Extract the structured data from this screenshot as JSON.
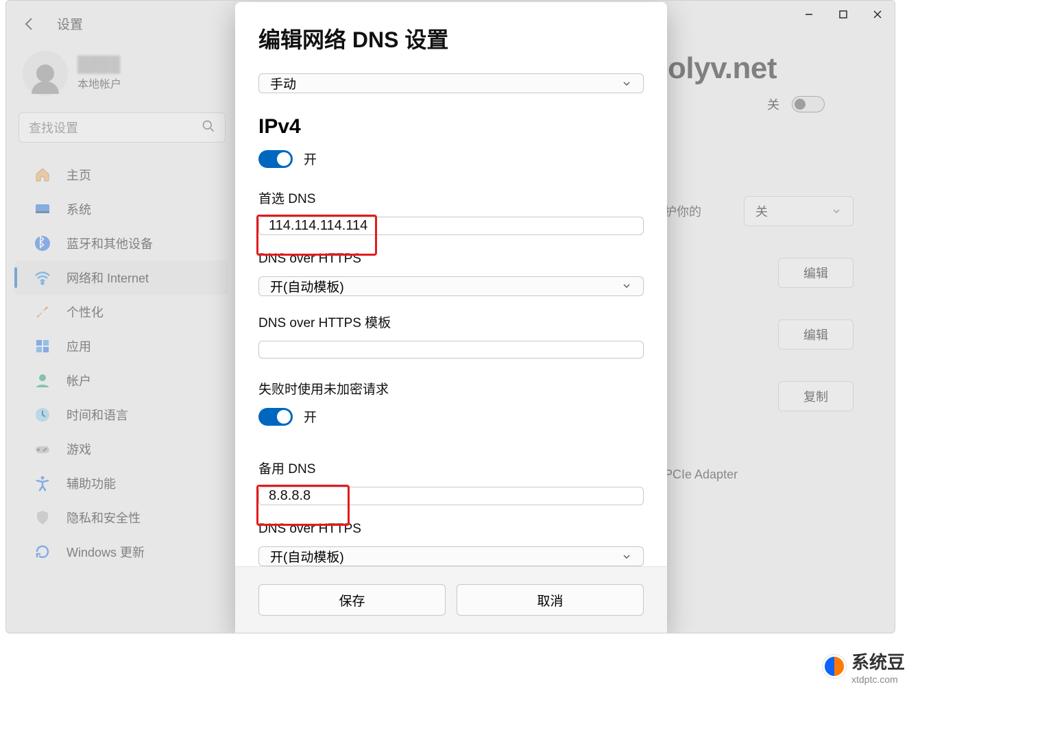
{
  "window": {
    "app_title": "设置",
    "minimize": "–",
    "maximize": "□",
    "close": "✕"
  },
  "profile": {
    "name_blurred": "████",
    "subtitle": "本地帐户"
  },
  "search": {
    "placeholder": "查找设置"
  },
  "nav": {
    "items": [
      {
        "label": "主页"
      },
      {
        "label": "系统"
      },
      {
        "label": "蓝牙和其他设备"
      },
      {
        "label": "网络和 Internet"
      },
      {
        "label": "个性化"
      },
      {
        "label": "应用"
      },
      {
        "label": "帐户"
      },
      {
        "label": "时间和语言"
      },
      {
        "label": "游戏"
      },
      {
        "label": "辅助功能"
      },
      {
        "label": "隐私和安全性"
      },
      {
        "label": "Windows 更新"
      }
    ],
    "active_index": 3
  },
  "background": {
    "domain_fragment": "olyv.net",
    "toggle_off_label": "关",
    "protect_text_fragment": "护你的",
    "select_off": "关",
    "adapter_fragment": "PCIe Adapter",
    "edit_label": "编辑",
    "copy_label": "复制"
  },
  "dialog": {
    "title": "编辑网络 DNS 设置",
    "mode_select": "手动",
    "ipv4_heading": "IPv4",
    "ipv4_toggle_label": "开",
    "preferred_dns_label": "首选 DNS",
    "preferred_dns_value": "114.114.114.114",
    "doh_label_1": "DNS over HTTPS",
    "doh_select_1": "开(自动模板)",
    "doh_template_label": "DNS over HTTPS 模板",
    "doh_template_value": "",
    "fallback_unenc_label": "失败时使用未加密请求",
    "fallback_toggle_label": "开",
    "alt_dns_label": "备用 DNS",
    "alt_dns_value": "8.8.8.8",
    "doh_label_2": "DNS over HTTPS",
    "doh_select_2": "开(自动模板)",
    "save_label": "保存",
    "cancel_label": "取消"
  },
  "watermark": {
    "brand": "系统豆",
    "url": "xtdptc.com"
  }
}
